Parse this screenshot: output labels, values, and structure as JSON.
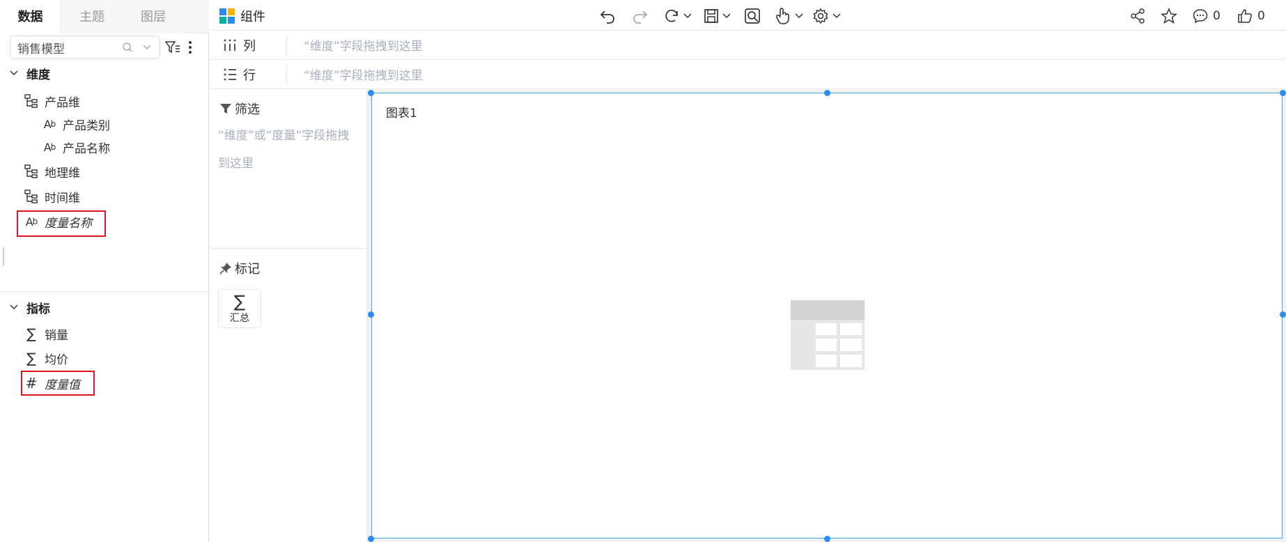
{
  "left_tabs": [
    "数据",
    "主题",
    "图层"
  ],
  "model_select": {
    "value": "销售模型"
  },
  "dimensions": {
    "heading": "维度",
    "items": [
      {
        "label": "产品维",
        "type": "hierarchy"
      },
      {
        "label": "产品类别",
        "type": "text",
        "icon_text": "Ab"
      },
      {
        "label": "产品名称",
        "type": "text",
        "icon_text": "Ab"
      },
      {
        "label": "地理维",
        "type": "hierarchy"
      },
      {
        "label": "时间维",
        "type": "hierarchy"
      },
      {
        "label": "度量名称",
        "type": "text",
        "icon_text": "Ab"
      }
    ]
  },
  "measures": {
    "heading": "指标",
    "items": [
      {
        "label": "销量",
        "icon_text": "∑"
      },
      {
        "label": "均价",
        "icon_text": "∑"
      },
      {
        "label": "度量值",
        "icon_text": "#"
      }
    ]
  },
  "toolbar": {
    "title": "组件",
    "comment_count": "0",
    "like_count": "0"
  },
  "shelves": {
    "columns": {
      "label": "列",
      "placeholder": "“维度”字段拖拽到这里"
    },
    "rows": {
      "label": "行",
      "placeholder": "“维度”字段拖拽到这里"
    }
  },
  "filter_panel": {
    "title": "筛选",
    "placeholder": "“维度”或“度量”字段拖拽到这里"
  },
  "marks_panel": {
    "title": "标记",
    "summary_icon": "∑",
    "summary_label": "汇总"
  },
  "chart": {
    "title": "图表1"
  },
  "colors": {
    "accent": "#2b8cf0",
    "highlight_box": "#e0141e",
    "placeholder_text": "#a8b0bc",
    "logo": [
      "#2b8cf0",
      "#f7b500",
      "#00b3a1",
      "#2b8cf0"
    ]
  }
}
